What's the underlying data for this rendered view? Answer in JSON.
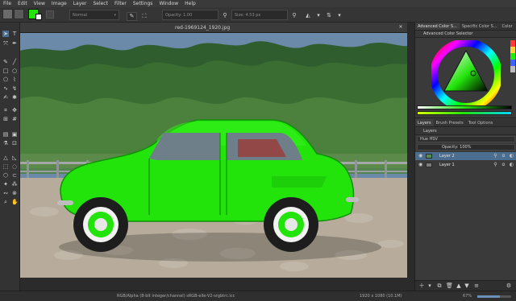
{
  "menubar": {
    "items": [
      "File",
      "Edit",
      "View",
      "Image",
      "Layer",
      "Select",
      "Filter",
      "Settings",
      "Window",
      "Help"
    ]
  },
  "toolbar": {
    "blend_mode": "Normal",
    "opacity_label": "Opacity: 1.00",
    "size_label": "Size: 4.53 px"
  },
  "document": {
    "tab_title": "red-1969124_1920.jpg",
    "status_left": "RGB/Alpha (8-bit integer/channel)  sRGB-elle-V2-srgbtrc.icc",
    "status_right": "1920 x 1080 (10.1M)",
    "zoom": "67%"
  },
  "dock": {
    "top_tabs": [
      "Advanced Color S...",
      "Specific Color S...",
      "Color"
    ],
    "advanced_color_selector_title": "Advanced Color Selector",
    "mid_tabs": [
      "Layers",
      "Brush Presets",
      "Tool Options"
    ],
    "layers_title": "Layers",
    "color_mode": "Hue HSV",
    "opacity_field": "Opacity: 100%",
    "layers": [
      {
        "name": "Layer 2",
        "active": true
      },
      {
        "name": "Layer 1",
        "active": false
      }
    ]
  },
  "colors": {
    "car_green": "#22e40a",
    "window_blue": "#4b6d8f",
    "panel_bg": "#3a3a3a"
  },
  "icons": {
    "lock": "lock-icon",
    "eye": "eye-icon",
    "alpha": "alpha-icon",
    "inherit": "inherit-alpha-icon"
  }
}
